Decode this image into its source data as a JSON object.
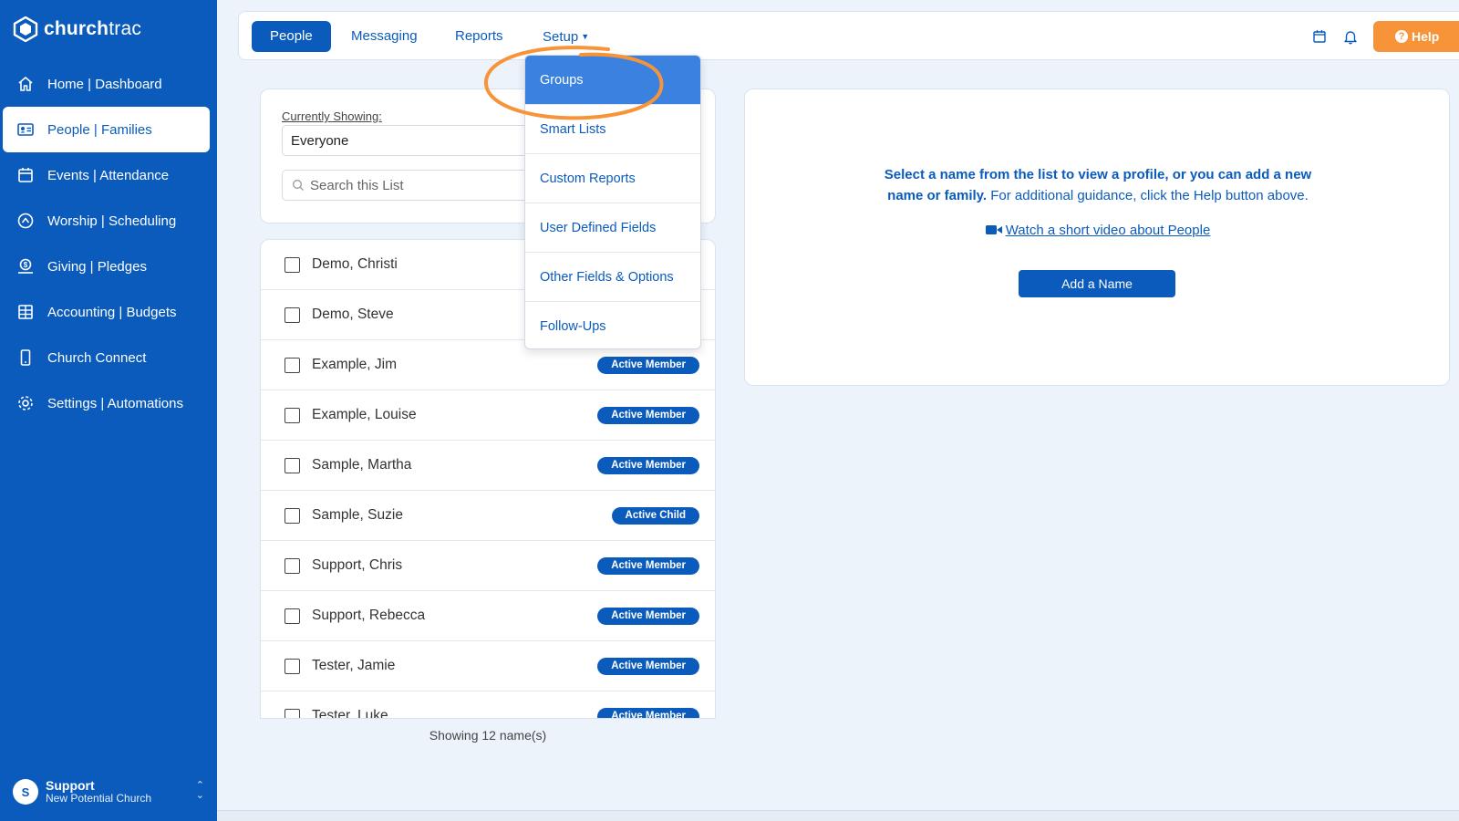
{
  "brand": {
    "name_part1": "church",
    "name_part2": "trac"
  },
  "sidebar": {
    "items": [
      {
        "label": "Home | Dashboard",
        "icon": "home-icon"
      },
      {
        "label": "People | Families",
        "icon": "id-card-icon",
        "active": true
      },
      {
        "label": "Events | Attendance",
        "icon": "calendar-icon"
      },
      {
        "label": "Worship | Scheduling",
        "icon": "worship-icon"
      },
      {
        "label": "Giving | Pledges",
        "icon": "giving-icon"
      },
      {
        "label": "Accounting | Budgets",
        "icon": "grid-icon"
      },
      {
        "label": "Church Connect",
        "icon": "phone-icon"
      },
      {
        "label": "Settings | Automations",
        "icon": "gear-icon"
      }
    ],
    "user": {
      "initial": "S",
      "name": "Support",
      "org": "New Potential Church"
    }
  },
  "topbar": {
    "tabs": [
      {
        "label": "People",
        "active": true
      },
      {
        "label": "Messaging"
      },
      {
        "label": "Reports"
      },
      {
        "label": "Setup"
      }
    ],
    "help_label": "Help"
  },
  "setup_menu": {
    "items": [
      {
        "label": "Groups",
        "active": true
      },
      {
        "label": "Smart Lists"
      },
      {
        "label": "Custom Reports"
      },
      {
        "label": "User Defined Fields"
      },
      {
        "label": "Other Fields & Options"
      },
      {
        "label": "Follow-Ups"
      }
    ]
  },
  "filter": {
    "label": "Currently Showing:",
    "selected": "Everyone",
    "search_placeholder": "Search this List"
  },
  "people": [
    {
      "name": "Demo, Christi",
      "status": ""
    },
    {
      "name": "Demo, Steve",
      "status": ""
    },
    {
      "name": "Example, Jim",
      "status": "Active Member"
    },
    {
      "name": "Example, Louise",
      "status": "Active Member"
    },
    {
      "name": "Sample, Martha",
      "status": "Active Member"
    },
    {
      "name": "Sample, Suzie",
      "status": "Active Child"
    },
    {
      "name": "Support, Chris",
      "status": "Active Member"
    },
    {
      "name": "Support, Rebecca",
      "status": "Active Member"
    },
    {
      "name": "Tester, Jamie",
      "status": "Active Member"
    },
    {
      "name": "Tester, Luke",
      "status": "Active Member"
    }
  ],
  "list_footer": "Showing 12 name(s)",
  "info": {
    "bold_text": "Select a name from the list to view a profile, or you can add a new name or family.",
    "normal_text": " For additional guidance, click the Help button above.",
    "video_link": "Watch a short video about People",
    "add_button": "Add a Name"
  },
  "colors": {
    "primary": "#0b5bbd",
    "accent": "#f7943a",
    "menu_active": "#3b82e0"
  }
}
